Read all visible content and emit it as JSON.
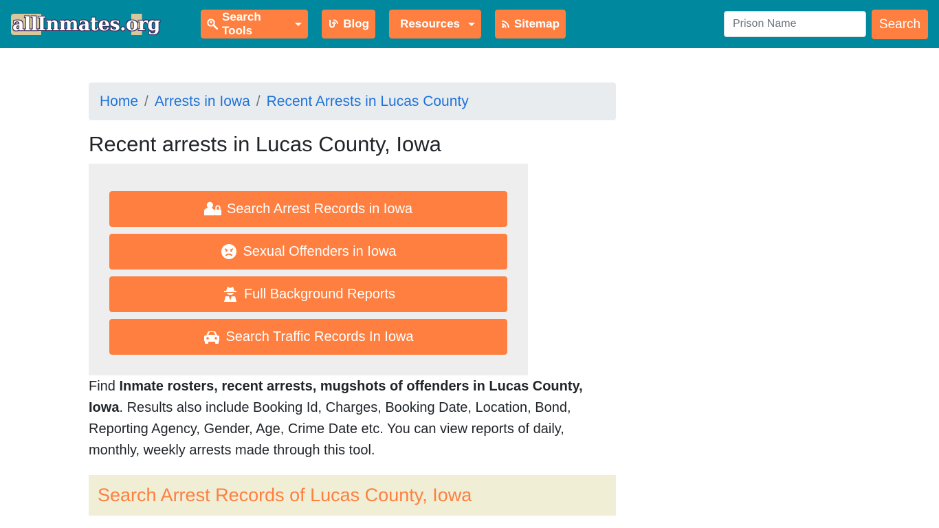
{
  "navbar": {
    "logo_text": "allInmates.org",
    "menu": [
      {
        "label": "Search Tools",
        "icon": "search-location-icon",
        "dropdown": true
      },
      {
        "label": "Blog",
        "icon": "blog-icon",
        "dropdown": false
      },
      {
        "label": "Resources",
        "icon": "leaf-icon",
        "dropdown": true
      },
      {
        "label": "Sitemap",
        "icon": "rss-icon",
        "dropdown": false
      }
    ],
    "search": {
      "placeholder": "Prison Name",
      "value": "",
      "button_label": "Search"
    }
  },
  "breadcrumb": [
    {
      "label": "Home"
    },
    {
      "label": "Arrests in Iowa"
    },
    {
      "label": "Recent Arrests in Lucas County"
    }
  ],
  "page_title": "Recent arrests in Lucas County, Iowa",
  "action_buttons": [
    {
      "label": "Search Arrest Records in Iowa",
      "icon": "user-lock-icon"
    },
    {
      "label": "Sexual Offenders in Iowa",
      "icon": "angry-face-icon"
    },
    {
      "label": "Full Background Reports",
      "icon": "user-secret-icon"
    },
    {
      "label": "Search Traffic Records In Iowa",
      "icon": "car-icon"
    }
  ],
  "description": {
    "prefix": "Find ",
    "bold": "Inmate rosters, recent arrests, mugshots of offenders in Lucas County, Iowa",
    "suffix": ". Results also include Booking Id, Charges, Booking Date, Location, Bond, Reporting Agency, Gender, Age, Crime Date etc. You can view reports of daily, monthly, weekly arrests made through this tool."
  },
  "section_header": "Search Arrest Records of Lucas County, Iowa",
  "colors": {
    "navbar_bg": "#00899e",
    "accent_orange": "#fe7f3f",
    "link_blue": "#1e73d8",
    "breadcrumb_bg": "#e9ecef",
    "panel_bg": "#eeeeee",
    "section_bg": "#f0eed5"
  }
}
